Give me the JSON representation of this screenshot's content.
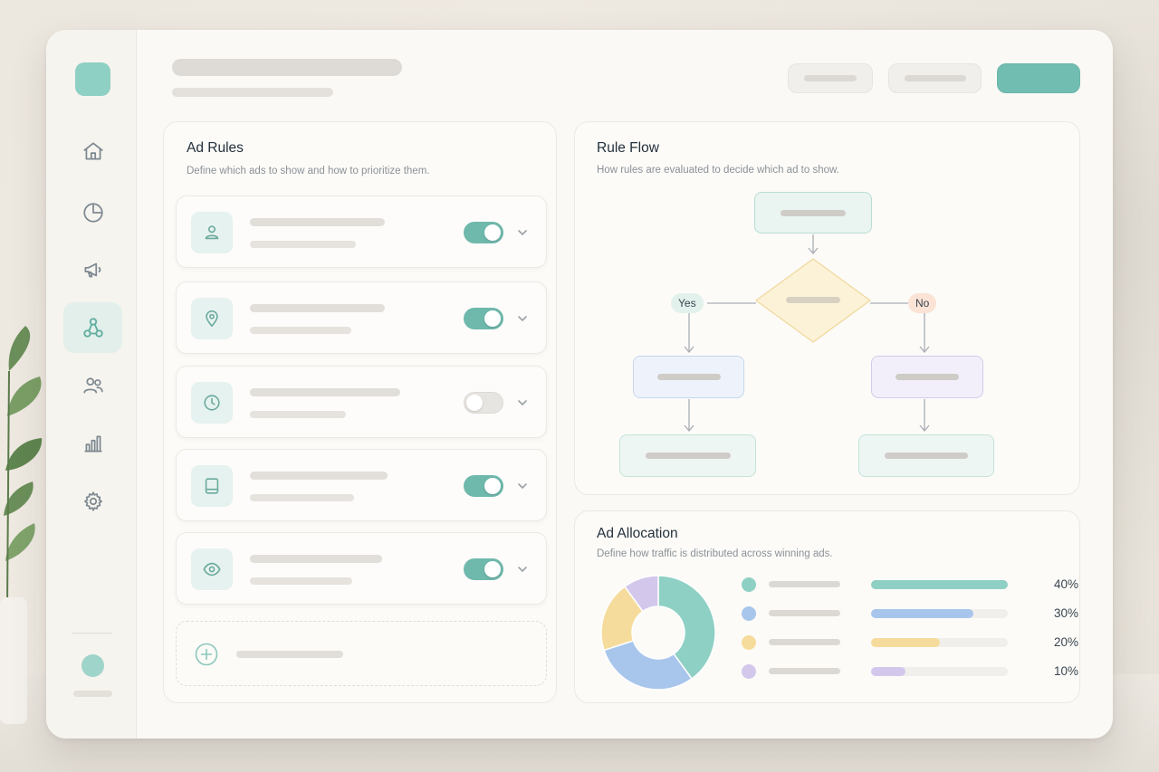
{
  "ad_rules": {
    "title": "Ad Rules",
    "subtitle": "Define which ads to show and how to prioritize them.",
    "rules": [
      {
        "icon": "user-icon",
        "enabled": true
      },
      {
        "icon": "location-pin-icon",
        "enabled": true
      },
      {
        "icon": "clock-icon",
        "enabled": false
      },
      {
        "icon": "tablet-icon",
        "enabled": true
      },
      {
        "icon": "eye-icon",
        "enabled": true
      }
    ]
  },
  "rule_flow": {
    "title": "Rule Flow",
    "subtitle": "How rules are evaluated to decide which ad to show.",
    "yes_label": "Yes",
    "no_label": "No"
  },
  "ad_allocation": {
    "title": "Ad Allocation",
    "subtitle": "Define how traffic is distributed across winning ads.",
    "items": [
      {
        "percent_label": "40%",
        "value": 40,
        "color": "#8fd0c4"
      },
      {
        "percent_label": "30%",
        "value": 30,
        "color": "#a8c6ec"
      },
      {
        "percent_label": "20%",
        "value": 20,
        "color": "#f6dc9c"
      },
      {
        "percent_label": "10%",
        "value": 10,
        "color": "#d3c8ec"
      }
    ]
  },
  "sidebar": {
    "items": [
      "home-icon",
      "pie-chart-icon",
      "megaphone-icon",
      "flow-icon",
      "users-icon",
      "bar-chart-icon",
      "gear-icon"
    ],
    "active": "flow-icon"
  },
  "colors": {
    "accent": "#72bdb1",
    "yes_pill": "#e3f1ec",
    "no_pill": "#fbe3d6"
  }
}
